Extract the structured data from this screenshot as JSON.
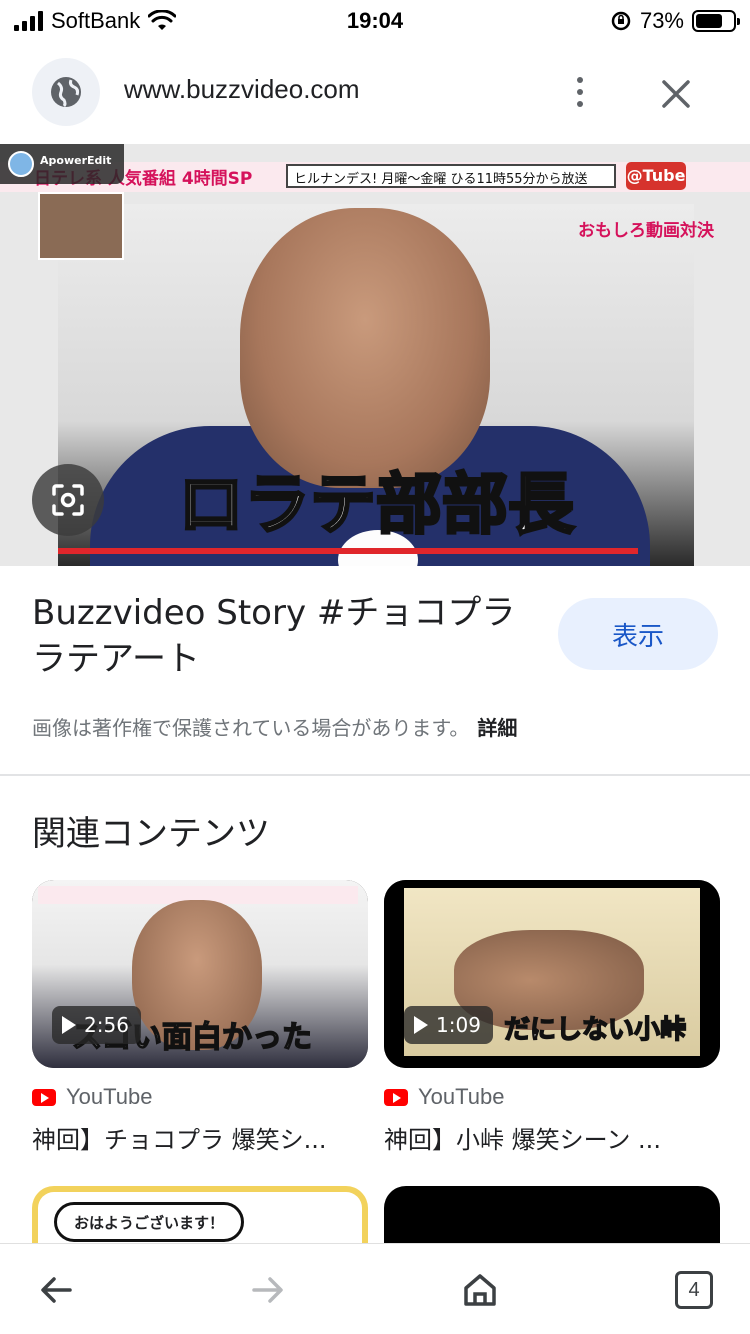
{
  "status_bar": {
    "carrier": "SoftBank",
    "time": "19:04",
    "battery_percent_text": "73%",
    "battery_level": 0.73,
    "icons": [
      "signal-icon",
      "wifi-icon",
      "rotation-lock-icon",
      "battery-icon"
    ]
  },
  "browser": {
    "url": "www.buzzvideo.com",
    "icons": [
      "globe-icon",
      "more-vert-icon",
      "close-icon"
    ]
  },
  "hero": {
    "watermark": "ApowerEdit",
    "banner_text": "日テレ系 人気番組 4時間SP",
    "search_text": "ヒルナンデス! 月曜〜金曜 ひる11時55分から放送",
    "tube_label": "@Tube",
    "subtitle": "おもしろ動画対決",
    "caption": "ロラテ部部長",
    "lens_icon": "lens-icon"
  },
  "result": {
    "title": "Buzzvideo Story #チョコプラ ラテアート",
    "view_button": "表示",
    "copyright_notice": "画像は著作権で保護されている場合があります。",
    "details_link": "詳細"
  },
  "related": {
    "heading": "関連コンテンツ",
    "items": [
      {
        "duration": "2:56",
        "thumb_caption": "スゴい面白かった",
        "source": "YouTube",
        "title": "神回】チョコプラ 爆笑シ..."
      },
      {
        "duration": "1:09",
        "thumb_caption": "だにしない小峠",
        "source": "YouTube",
        "title": "神回】小峠 爆笑シーン ..."
      }
    ],
    "lower_bubble": "おはようございます！"
  },
  "toolbar": {
    "tab_count": "4",
    "icons": [
      "back-arrow-icon",
      "forward-arrow-icon",
      "home-icon",
      "tabs-icon"
    ]
  },
  "colors": {
    "accent_blue": "#1a57c7",
    "button_bg": "#e8f0fe",
    "youtube_red": "#ff0000"
  }
}
